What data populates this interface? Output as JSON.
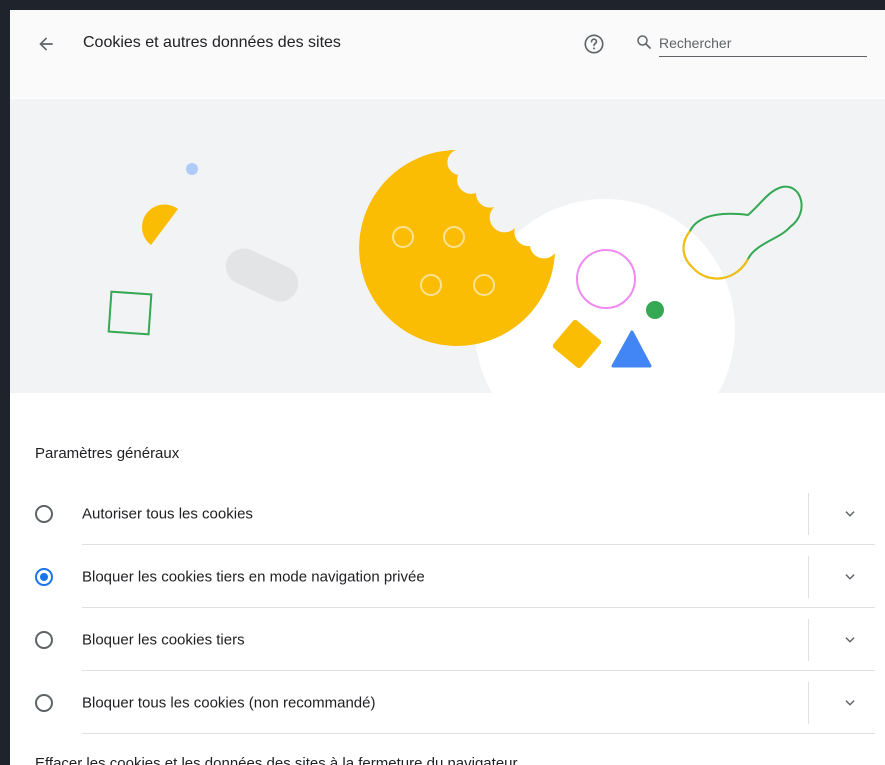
{
  "header": {
    "title": "Cookies et autres données des sites",
    "back_icon": "arrow-left-icon",
    "help_icon": "help-circle-icon",
    "search_icon": "search-icon",
    "search_placeholder": "Rechercher"
  },
  "settings": {
    "heading": "Paramètres généraux",
    "options": [
      {
        "label": "Autoriser tous les cookies",
        "selected": false
      },
      {
        "label": "Bloquer les cookies tiers en mode navigation privée",
        "selected": true
      },
      {
        "label": "Bloquer les cookies tiers",
        "selected": false
      },
      {
        "label": "Bloquer tous les cookies (non recommandé)",
        "selected": false
      }
    ]
  },
  "footer": {
    "partial_text": "Effacer les cookies et les données des sites à la fermeture du navigateur"
  },
  "colors": {
    "accent": "#1a73e8",
    "cookie": "#fbbc04",
    "green": "#34a853",
    "blue": "#4285f4",
    "pink": "#f08af0"
  }
}
